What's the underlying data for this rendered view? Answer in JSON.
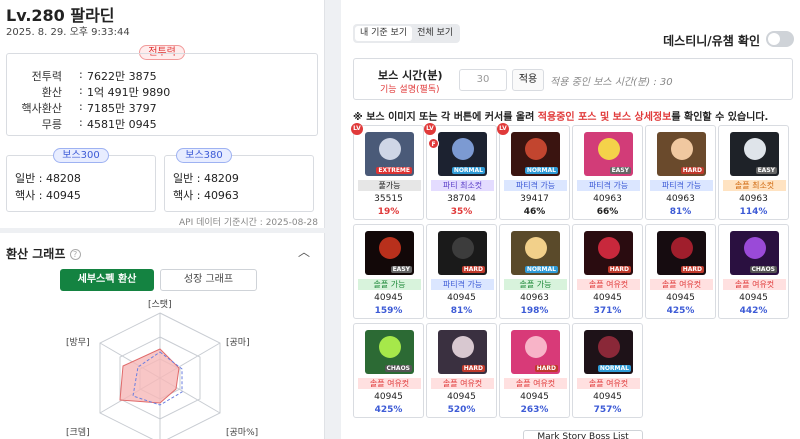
{
  "character": {
    "title": "Lv.280 팔라딘",
    "datetime": "2025. 8. 29. 오후 9:33:44",
    "combat_pill": "전투력",
    "stats": [
      {
        "label": "전투력",
        "value": "7622만 3875"
      },
      {
        "label": "환산",
        "value": "1억 491만 9890"
      },
      {
        "label": "핵사환산",
        "value": "7185만 3797"
      },
      {
        "label": "무릉",
        "value": "4581만 0945"
      }
    ],
    "stat_colon": ":",
    "boss300": {
      "pill": "보스300",
      "normal": "일반 : 48208",
      "hexa": "핵사 : 40945"
    },
    "boss380": {
      "pill": "보스380",
      "normal": "일반 : 48209",
      "hexa": "핵사 : 40963"
    },
    "api_note": "API 데이터 기준시간 : 2025-08-28"
  },
  "graph": {
    "title": "환산 그래프",
    "help": "?",
    "collapse": "︿",
    "tab_active": "세부스펙 환산",
    "tab_inactive": "성장 그래프",
    "labels": {
      "top": "[스탯]",
      "right_top": "[공마]",
      "right_bottom": "[공마%]",
      "left_top": "[방무]",
      "left_bottom": "[크뎀]"
    },
    "colors": {
      "fill": "#f6b8b8",
      "stroke": "#e06a6a",
      "dashed": "#6b7fe0"
    }
  },
  "right": {
    "tab_my": "내 기준 보기",
    "tab_all": "전체 보기",
    "destiny_label": "데스티니/유챔 확인",
    "boss_time_label": "보스 시간(분)",
    "boss_time_sub": "기능 설명(펼독)",
    "boss_time_input": "30",
    "apply": "적용",
    "applied_note": "적용 중인 보스 시간(분) : 30",
    "notice_pre": "※ 보스 이미지 또는 각 버튼에 커서를 올려 ",
    "notice_red": "적용중인 포스 및 보스 상세정보",
    "notice_post": "를 확인할 수 있습니다.",
    "bottom_button": "Mark Story Boss List"
  },
  "bosses": [
    {
      "diff": "EXTREME",
      "status": "풀가능",
      "value": "35515",
      "pct": "19%",
      "color": "#4a5a78",
      "face": "#cfd6e6",
      "st_bg": "#e6e6e6",
      "st_fg": "#222",
      "pct_fg": "#e03a3a",
      "lv": true,
      "f": false,
      "diff_bg": "#d33"
    },
    {
      "diff": "NORMAL",
      "status": "파티 최소컷",
      "value": "38704",
      "pct": "35%",
      "color": "#1c2230",
      "face": "#7c9ad2",
      "st_bg": "#e4dcff",
      "st_fg": "#5b3ec8",
      "pct_fg": "#e03a3a",
      "lv": true,
      "f": true,
      "diff_bg": "#2f9bd6"
    },
    {
      "diff": "NORMAL",
      "status": "파티격 가능",
      "value": "39417",
      "pct": "46%",
      "color": "#3a1410",
      "face": "#c2452f",
      "st_bg": "#dbe6ff",
      "st_fg": "#3d5bd6",
      "pct_fg": "#222",
      "lv": true,
      "f": false,
      "diff_bg": "#2f9bd6"
    },
    {
      "diff": "EASY",
      "status": "파티격 가능",
      "value": "40963",
      "pct": "66%",
      "color": "#d23c78",
      "face": "#f4d24a",
      "st_bg": "#dbe6ff",
      "st_fg": "#3d5bd6",
      "pct_fg": "#222",
      "lv": false,
      "f": false,
      "diff_bg": "#666"
    },
    {
      "diff": "HARD",
      "status": "파티격 가능",
      "value": "40963",
      "pct": "81%",
      "color": "#6a4a2c",
      "face": "#f0c8a0",
      "st_bg": "#dbe6ff",
      "st_fg": "#3d5bd6",
      "pct_fg": "#3d5bd6",
      "lv": false,
      "f": false,
      "diff_bg": "#c0392b"
    },
    {
      "diff": "EASY",
      "status": "솔플 최소컷",
      "value": "40963",
      "pct": "114%",
      "color": "#1e2228",
      "face": "#dfe4ea",
      "st_bg": "#ffe3c2",
      "st_fg": "#d06a10",
      "pct_fg": "#3d5bd6",
      "lv": false,
      "f": false,
      "diff_bg": "#666"
    },
    {
      "diff": "EASY",
      "status": "솔플 가능",
      "value": "40945",
      "pct": "159%",
      "color": "#120808",
      "face": "#b8301c",
      "st_bg": "#d8f3dc",
      "st_fg": "#1f8a3a",
      "pct_fg": "#3d5bd6",
      "lv": false,
      "f": false,
      "diff_bg": "#666"
    },
    {
      "diff": "HARD",
      "status": "파티격 가능",
      "value": "40945",
      "pct": "81%",
      "color": "#1a1a1a",
      "face": "#3c3c3c",
      "st_bg": "#dbe6ff",
      "st_fg": "#3d5bd6",
      "pct_fg": "#3d5bd6",
      "lv": false,
      "f": false,
      "diff_bg": "#c0392b"
    },
    {
      "diff": "NORMAL",
      "status": "솔플 가능",
      "value": "40963",
      "pct": "198%",
      "color": "#5a4a2a",
      "face": "#f2d08a",
      "st_bg": "#d8f3dc",
      "st_fg": "#1f8a3a",
      "pct_fg": "#3d5bd6",
      "lv": false,
      "f": false,
      "diff_bg": "#2f9bd6"
    },
    {
      "diff": "HARD",
      "status": "솔플 여유컷",
      "value": "40945",
      "pct": "371%",
      "color": "#2a0c10",
      "face": "#c8283c",
      "st_bg": "#ffe0e0",
      "st_fg": "#e03a3a",
      "pct_fg": "#3d5bd6",
      "lv": false,
      "f": false,
      "diff_bg": "#c0392b"
    },
    {
      "diff": "HARD",
      "status": "솔플 여유컷",
      "value": "40945",
      "pct": "425%",
      "color": "#160c10",
      "face": "#a01e2c",
      "st_bg": "#ffe0e0",
      "st_fg": "#e03a3a",
      "pct_fg": "#3d5bd6",
      "lv": false,
      "f": false,
      "diff_bg": "#c0392b"
    },
    {
      "diff": "CHAOS",
      "status": "솔플 여유컷",
      "value": "40945",
      "pct": "442%",
      "color": "#2a1040",
      "face": "#9a4ad8",
      "st_bg": "#ffe0e0",
      "st_fg": "#e03a3a",
      "pct_fg": "#3d5bd6",
      "lv": false,
      "f": false,
      "diff_bg": "#555"
    },
    {
      "diff": "CHAOS",
      "status": "솔플 여유컷",
      "value": "40945",
      "pct": "425%",
      "color": "#2c6a34",
      "face": "#a6e84a",
      "st_bg": "#ffe0e0",
      "st_fg": "#e03a3a",
      "pct_fg": "#3d5bd6",
      "lv": false,
      "f": false,
      "diff_bg": "#555"
    },
    {
      "diff": "HARD",
      "status": "솔플 여유컷",
      "value": "40945",
      "pct": "520%",
      "color": "#3a3040",
      "face": "#d8c8d0",
      "st_bg": "#ffe0e0",
      "st_fg": "#e03a3a",
      "pct_fg": "#3d5bd6",
      "lv": false,
      "f": false,
      "diff_bg": "#c0392b"
    },
    {
      "diff": "HARD",
      "status": "솔플 여유컷",
      "value": "40945",
      "pct": "263%",
      "color": "#d83a78",
      "face": "#f8b4c8",
      "st_bg": "#ffe0e0",
      "st_fg": "#e03a3a",
      "pct_fg": "#3d5bd6",
      "lv": false,
      "f": false,
      "diff_bg": "#c0392b"
    },
    {
      "diff": "NORMAL",
      "status": "솔플 여유컷",
      "value": "40945",
      "pct": "757%",
      "color": "#1e1218",
      "face": "#8a2838",
      "st_bg": "#ffe0e0",
      "st_fg": "#e03a3a",
      "pct_fg": "#3d5bd6",
      "lv": false,
      "f": false,
      "diff_bg": "#2f9bd6"
    }
  ]
}
